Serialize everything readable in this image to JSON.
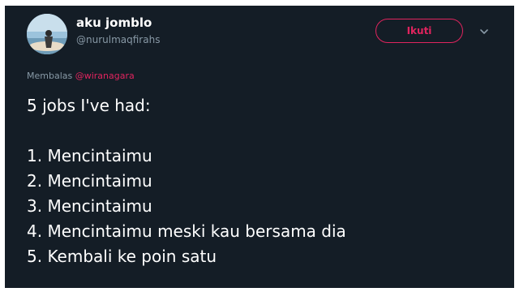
{
  "tweet": {
    "user": {
      "name": "aku jomblo",
      "handle": "@nurulmaqfirahs"
    },
    "follow_label": "Ikuti",
    "menu_icon": "chevron-down-icon",
    "reply_prefix": "Membalas",
    "reply_mention": "@wiranagara",
    "heading": "5 jobs I've had:",
    "lines": [
      "1. Mencintaimu",
      "2. Mencintaimu",
      "3. Mencintaimu",
      "4. Mencintaimu meski kau bersama dia",
      "5. Kembali ke poin satu"
    ]
  },
  "colors": {
    "background": "#141d26",
    "accent": "#e0245e",
    "muted": "#8899a6",
    "text": "#ffffff"
  }
}
